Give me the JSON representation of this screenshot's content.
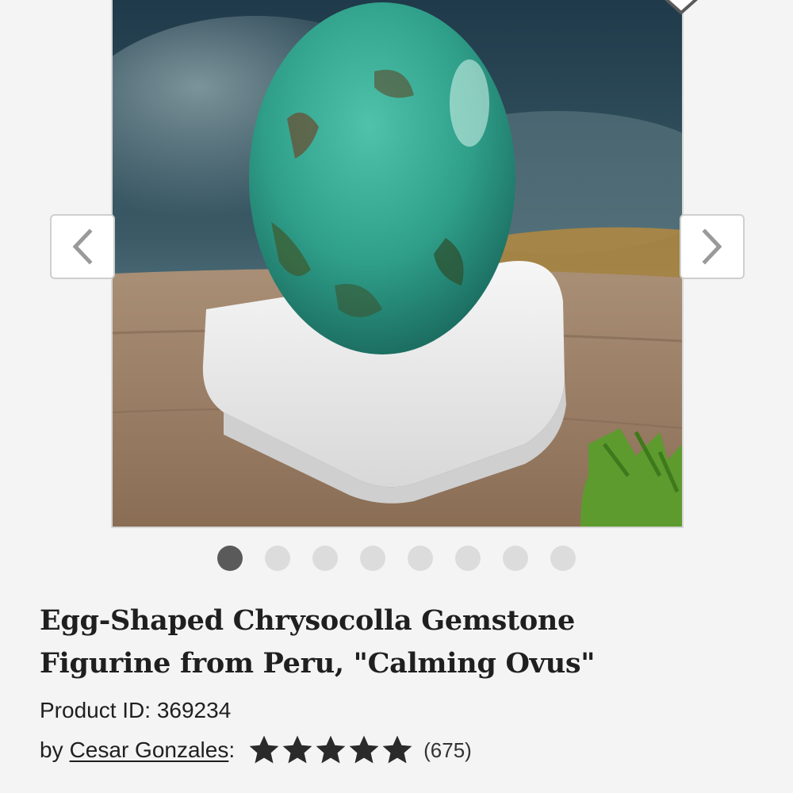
{
  "product": {
    "title_line1": "Egg-Shaped Chrysocolla Gemstone",
    "title_line2": "Figurine from Peru, \"Calming Ovus\"",
    "product_id_label": "Product ID: 369234",
    "by_label": "by",
    "artist_name": "Cesar Gonzales",
    "artist_suffix": ":",
    "rating_stars": 5,
    "review_count": "(675)"
  },
  "gallery": {
    "image_description_icon": "product-photo",
    "prev_icon": "chevron-left-icon",
    "next_icon": "chevron-right-icon",
    "prev_glyph": "❮",
    "next_glyph": "❯",
    "dot_count": 8,
    "active_dot": 1
  },
  "colors": {
    "star": "#2a2a2a",
    "dot_active": "#5a5a5a",
    "dot_inactive": "#dcdcdc"
  }
}
